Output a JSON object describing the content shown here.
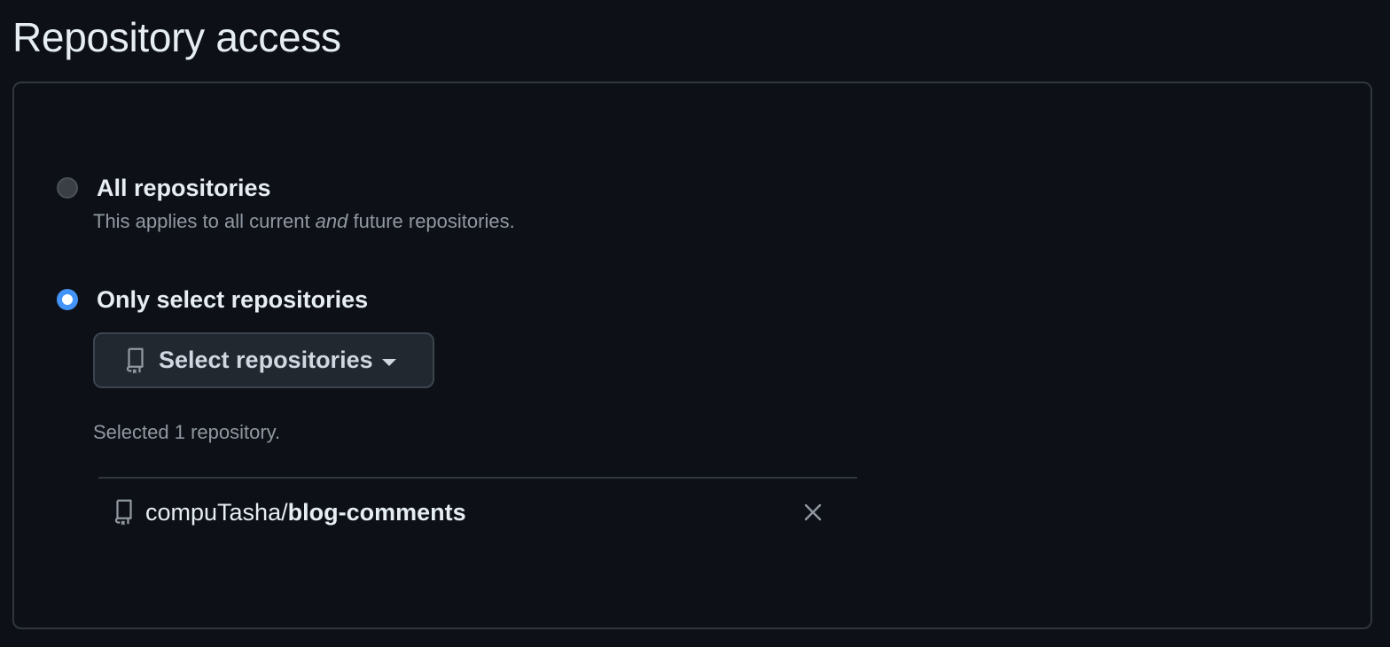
{
  "page": {
    "title": "Repository access"
  },
  "options": {
    "all": {
      "label": "All repositories",
      "desc_before": "This applies to all current ",
      "desc_emphasis": "and",
      "desc_after": " future repositories.",
      "checked": false
    },
    "select": {
      "label": "Only select repositories",
      "checked": true
    }
  },
  "select_button": {
    "label": "Select repositories",
    "icon": "repo-icon",
    "dropdown_icon": "caret-down-icon"
  },
  "selection": {
    "count_text": "Selected 1 repository.",
    "repositories": [
      {
        "owner": "compuTasha/",
        "name": "blog-comments",
        "icon": "repo-icon",
        "remove_icon": "close-icon"
      }
    ]
  },
  "colors": {
    "background": "#0d1117",
    "border": "#30363d",
    "accent": "#4493f8",
    "text_primary": "#e6edf3",
    "text_muted": "#9198a1",
    "button_bg": "#212830"
  }
}
